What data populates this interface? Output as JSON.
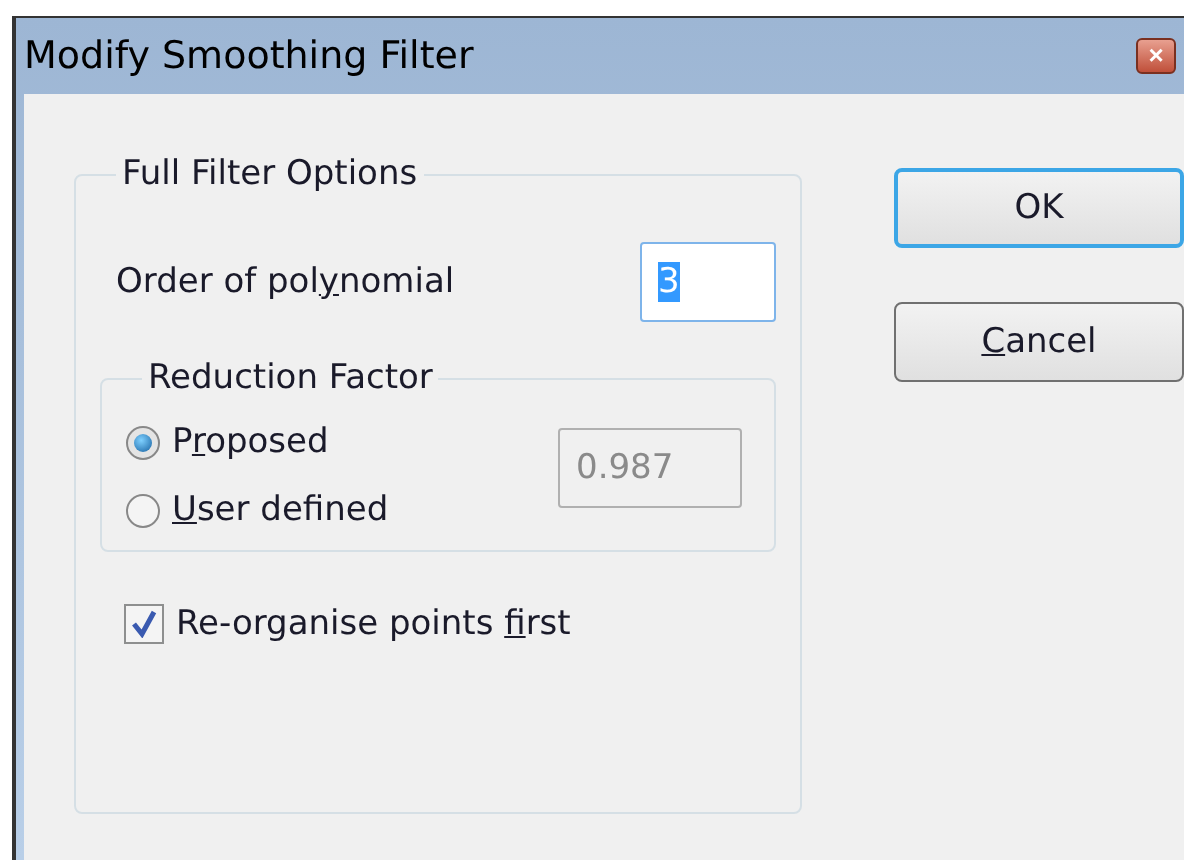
{
  "window": {
    "title": "Modify Smoothing Filter",
    "close_symbol": "×"
  },
  "group": {
    "title": "Full Filter Options"
  },
  "order": {
    "label": {
      "pre": "Order of pol",
      "key": "y",
      "post": "nomial"
    },
    "value": "3",
    "value_selected": true
  },
  "reduction": {
    "title": "Reduction Factor",
    "value": "0.987",
    "value_disabled": true,
    "options": [
      {
        "label": {
          "pre": "P",
          "key": "r",
          "post": "oposed"
        },
        "selected": true
      },
      {
        "label": {
          "key": "U",
          "post": "ser defined"
        },
        "selected": false
      }
    ]
  },
  "reorganise": {
    "label": {
      "pre": "Re-organise points ",
      "key": "f",
      "post": "irst"
    },
    "checked": true
  },
  "buttons": [
    {
      "label": {
        "post": "OK"
      },
      "default": true
    },
    {
      "label": {
        "key": "C",
        "post": "ancel"
      },
      "default": false
    }
  ]
}
